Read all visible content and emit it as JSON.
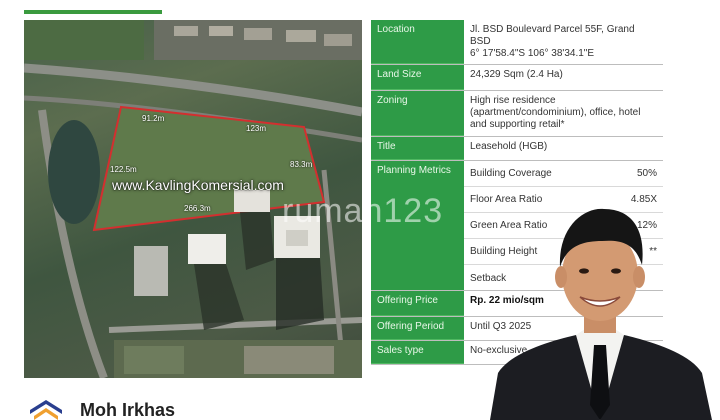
{
  "map": {
    "watermark": "www.KavlingKomersial.com",
    "dimensions": [
      "91.2m",
      "123m",
      "122.5m",
      "83.3m",
      "266.3m"
    ]
  },
  "spec": {
    "location": {
      "label": "Location",
      "value": "Jl. BSD Boulevard Parcel 55F, Grand BSD",
      "coords": "6° 17'58.4\"S 106° 38'34.1\"E"
    },
    "land_size": {
      "label": "Land Size",
      "value": "24,329 Sqm (2.4 Ha)"
    },
    "zoning": {
      "label": "Zoning",
      "value": "High rise residence (apartment/condominium), office, hotel and supporting retail*"
    },
    "title": {
      "label": "Title",
      "value": "Leasehold (HGB)"
    },
    "planning": {
      "label": "Planning Metrics",
      "items": [
        {
          "name": "Building Coverage",
          "value": "50%"
        },
        {
          "name": "Floor Area Ratio",
          "value": "4.85X"
        },
        {
          "name": "Green Area Ratio",
          "value": "12%"
        },
        {
          "name": "Building Height",
          "value": "**"
        },
        {
          "name": "Setback",
          "value": ""
        }
      ]
    },
    "offering_price": {
      "label": "Offering Price",
      "value": "Rp. 22 mio/sqm"
    },
    "offering_period": {
      "label": "Offering Period",
      "value": "Until Q3 2025"
    },
    "sales_type": {
      "label": "Sales type",
      "value": "No-exclusive"
    }
  },
  "page_watermark": "rumah123",
  "agent": {
    "name": "Moh Irkhas",
    "logo_icon": "roof-logo-icon"
  }
}
